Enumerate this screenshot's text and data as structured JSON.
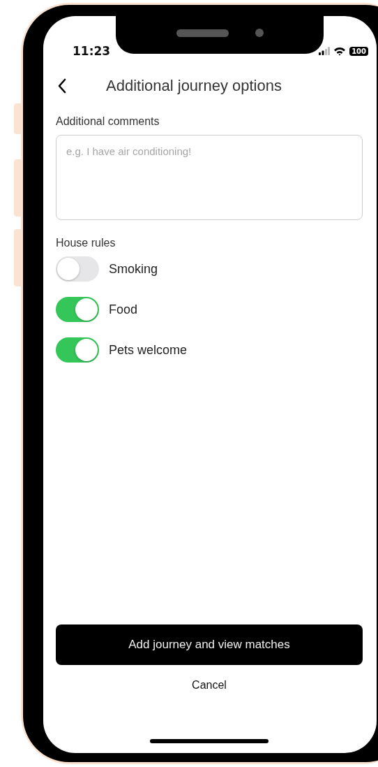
{
  "status_bar": {
    "time": "11:23",
    "battery": "100"
  },
  "header": {
    "title": "Additional journey options"
  },
  "comments": {
    "label": "Additional comments",
    "placeholder": "e.g. I have air conditioning!"
  },
  "house_rules": {
    "label": "House rules",
    "rules": [
      {
        "label": "Smoking",
        "on": false
      },
      {
        "label": "Food",
        "on": true
      },
      {
        "label": "Pets welcome",
        "on": true
      }
    ]
  },
  "actions": {
    "primary": "Add journey and view matches",
    "secondary": "Cancel"
  }
}
